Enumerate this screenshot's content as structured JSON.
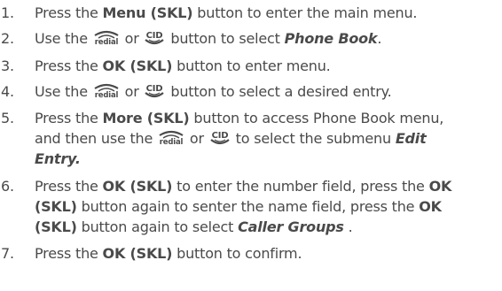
{
  "steps": [
    {
      "num": "1.",
      "parts": [
        "Press the ",
        "Menu (SKL)",
        " button to enter the main menu."
      ]
    },
    {
      "num": "2.",
      "parts": [
        "Use the ",
        " or ",
        " button to select ",
        "Phone Book",
        "."
      ]
    },
    {
      "num": "3.",
      "parts": [
        "Press the ",
        "OK (SKL)",
        " button to enter menu."
      ]
    },
    {
      "num": "4.",
      "parts": [
        "Use the ",
        " or ",
        " button to select a desired entry."
      ]
    },
    {
      "num": "5.",
      "parts": [
        "Press the ",
        "More (SKL)",
        " button to access Phone Book menu,",
        "and then use the ",
        " or ",
        " to select the submenu ",
        "Edit",
        "Entry."
      ]
    },
    {
      "num": "6.",
      "parts": [
        "Press the ",
        "OK (SKL)",
        " to enter the number field, press the ",
        "OK",
        "(SKL)",
        " button again to senter the name field, press the ",
        "OK",
        "(SKL)",
        " button again to select ",
        "Caller Groups",
        " ."
      ]
    },
    {
      "num": "7.",
      "parts": [
        "Press the ",
        "OK (SKL)",
        " button to confirm."
      ]
    }
  ],
  "icons": {
    "redial": {
      "name": "redial-button-icon",
      "text": "redial"
    },
    "cid": {
      "name": "cid-button-icon",
      "text": "CID"
    }
  },
  "colors": {
    "text": "#4a4a4a"
  }
}
